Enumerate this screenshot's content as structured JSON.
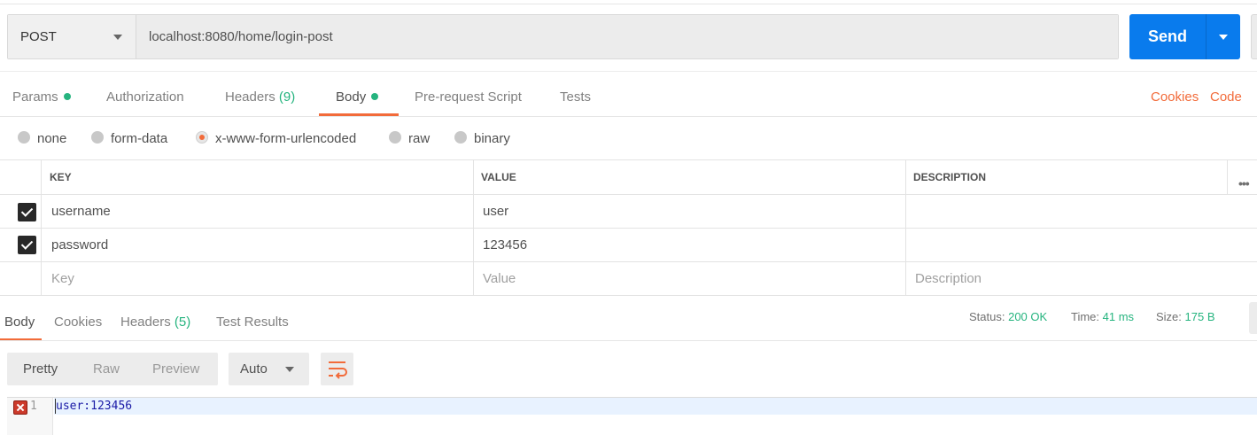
{
  "request": {
    "method": "POST",
    "url": "localhost:8080/home/login-post",
    "send_label": "Send"
  },
  "request_tabs": [
    {
      "label": "Params",
      "dot": true
    },
    {
      "label": "Authorization"
    },
    {
      "label": "Headers",
      "count": "(9)"
    },
    {
      "label": "Body",
      "dot": true,
      "active": true
    },
    {
      "label": "Pre-request Script"
    },
    {
      "label": "Tests"
    }
  ],
  "links": {
    "cookies": "Cookies",
    "code": "Code"
  },
  "body_types": [
    {
      "label": "none"
    },
    {
      "label": "form-data"
    },
    {
      "label": "x-www-form-urlencoded",
      "selected": true
    },
    {
      "label": "raw"
    },
    {
      "label": "binary"
    }
  ],
  "kv_table": {
    "headers": {
      "key": "KEY",
      "value": "VALUE",
      "description": "DESCRIPTION"
    },
    "rows": [
      {
        "key": "username",
        "value": "user",
        "description": "",
        "checked": true
      },
      {
        "key": "password",
        "value": "123456",
        "description": "",
        "checked": true
      }
    ],
    "placeholders": {
      "key": "Key",
      "value": "Value",
      "description": "Description"
    }
  },
  "response_tabs": [
    {
      "label": "Body",
      "active": true
    },
    {
      "label": "Cookies"
    },
    {
      "label": "Headers",
      "count": "(5)"
    },
    {
      "label": "Test Results"
    }
  ],
  "status": {
    "status_label": "Status:",
    "status_value": "200 OK",
    "time_label": "Time:",
    "time_value": "41 ms",
    "size_label": "Size:",
    "size_value": "175 B"
  },
  "response_toolbar": {
    "formats": [
      "Pretty",
      "Raw",
      "Preview"
    ],
    "active_format": "Pretty",
    "language": "Auto"
  },
  "response_body": {
    "line_number": "1",
    "text": "user:123456"
  },
  "colors": {
    "accent": "#f26b3a",
    "send_blue": "#097bed",
    "success_green": "#26b47f"
  }
}
